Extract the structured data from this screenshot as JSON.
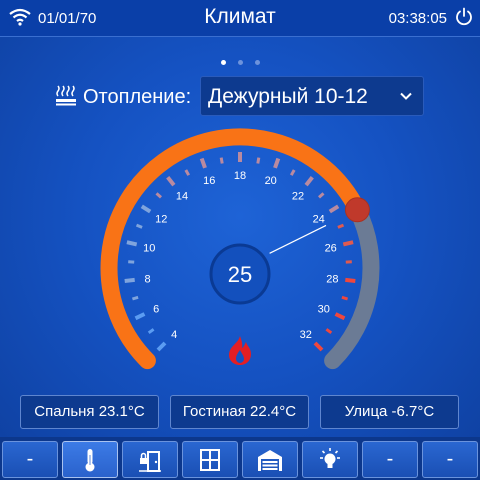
{
  "status_bar": {
    "date": "01/01/70",
    "title": "Климат",
    "time": "03:38:05"
  },
  "pager": {
    "count": 3,
    "active": 0
  },
  "heating": {
    "label": "Отопление:",
    "mode": "Дежурный 10-12"
  },
  "gauge": {
    "min": 4,
    "max": 32,
    "tick_labels": [
      "4",
      "6",
      "8",
      "10",
      "12",
      "14",
      "16",
      "18",
      "20",
      "22",
      "24",
      "26",
      "28",
      "30",
      "32"
    ],
    "current_value": "25",
    "current_temp": 25,
    "setpoint": 24.6,
    "colors": {
      "arc_active": "#f97316",
      "arc_inactive": "#6b7b95",
      "knob": "#c0392b",
      "flame": "#e31e24"
    }
  },
  "rooms": [
    {
      "label": "Спальня 23.1°C"
    },
    {
      "label": "Гостиная 22.4°C"
    },
    {
      "label": "Улица -6.7°C"
    }
  ],
  "nav_tabs": [
    {
      "label": "-",
      "icon": ""
    },
    {
      "label": "",
      "icon": "thermometer-icon"
    },
    {
      "label": "",
      "icon": "door-lock-icon"
    },
    {
      "label": "",
      "icon": "window-icon"
    },
    {
      "label": "",
      "icon": "garage-icon"
    },
    {
      "label": "",
      "icon": "light-bulb-icon"
    },
    {
      "label": "-",
      "icon": ""
    },
    {
      "label": "-",
      "icon": ""
    }
  ]
}
